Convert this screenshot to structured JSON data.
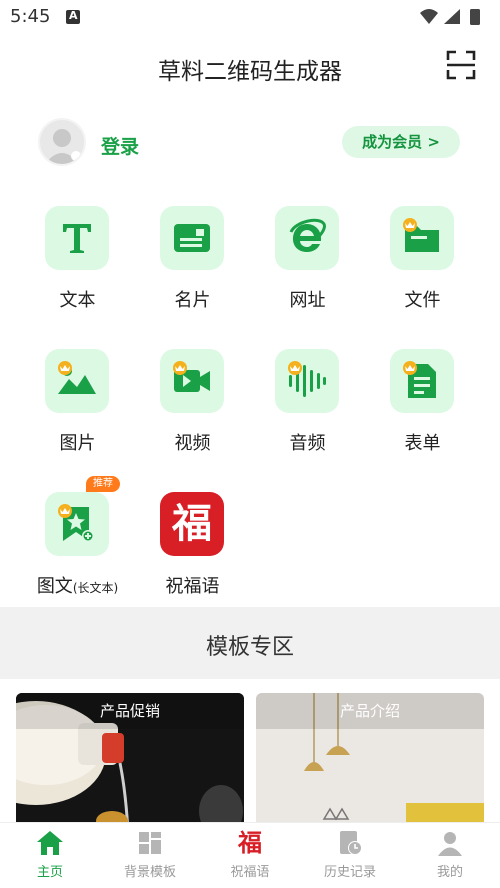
{
  "status_bar": {
    "time": "5:45"
  },
  "header": {
    "title": "草料二维码生成器"
  },
  "user": {
    "login_label": "登录",
    "vip_label": "成为会员 >"
  },
  "tools": [
    {
      "label": "文本",
      "icon": "text-t-icon",
      "premium": false
    },
    {
      "label": "名片",
      "icon": "business-card-icon",
      "premium": false
    },
    {
      "label": "网址",
      "icon": "browser-e-icon",
      "premium": false
    },
    {
      "label": "文件",
      "icon": "folder-icon",
      "premium": true
    },
    {
      "label": "图片",
      "icon": "image-icon",
      "premium": true
    },
    {
      "label": "视频",
      "icon": "video-camera-icon",
      "premium": true
    },
    {
      "label": "音频",
      "icon": "audio-wave-icon",
      "premium": true
    },
    {
      "label": "表单",
      "icon": "form-doc-icon",
      "premium": true
    },
    {
      "label": "图文",
      "sub_label": "(长文本)",
      "icon": "bookmark-star-icon",
      "premium": true,
      "badge": "推荐"
    },
    {
      "label": "祝福语",
      "icon": "fu-character-icon",
      "premium": false
    }
  ],
  "fu_char": "福",
  "section": {
    "title": "模板专区"
  },
  "templates": [
    {
      "label": "产品促销"
    },
    {
      "label": "产品介绍"
    }
  ],
  "bottom_nav": [
    {
      "label": "主页",
      "icon": "home-icon",
      "active": true
    },
    {
      "label": "背景模板",
      "icon": "template-grid-icon",
      "active": false
    },
    {
      "label": "祝福语",
      "icon": "fu-icon",
      "active": false
    },
    {
      "label": "历史记录",
      "icon": "history-icon",
      "active": false
    },
    {
      "label": "我的",
      "icon": "profile-icon",
      "active": false
    }
  ],
  "colors": {
    "brand_green": "#1aa046",
    "tile_bg": "#dcf9e4",
    "crown": "#f5b11d",
    "fu_red": "#d81f26",
    "badge_orange": "#ff7a1a"
  }
}
